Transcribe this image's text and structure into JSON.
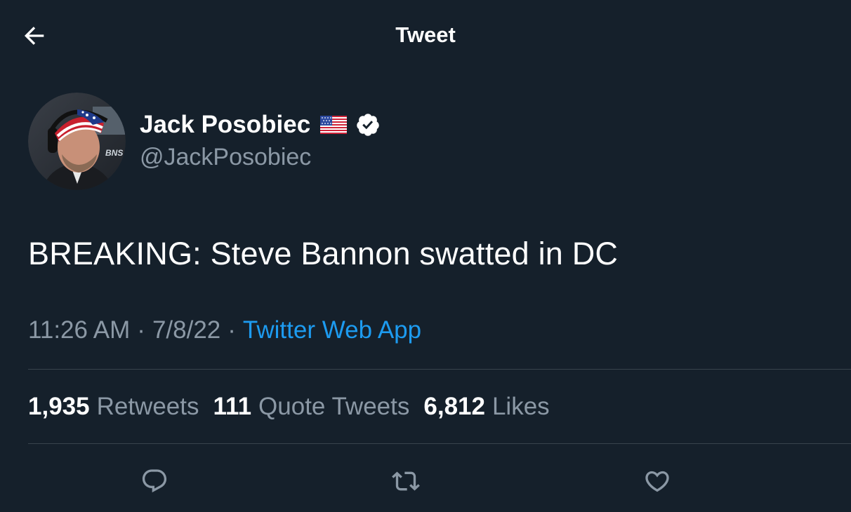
{
  "header": {
    "title": "Tweet",
    "back_icon": "arrow-left-icon"
  },
  "author": {
    "display_name": "Jack Posobiec",
    "handle": "@JackPosobiec",
    "flag_icon": "us-flag-icon",
    "verified_icon": "verified-badge-icon"
  },
  "tweet": {
    "text": "BREAKING: Steve Bannon swatted in DC",
    "time": "11:26 AM",
    "date": "7/8/22",
    "source": "Twitter Web App",
    "separator": "·"
  },
  "stats": {
    "retweets_count": "1,935",
    "retweets_label": "Retweets",
    "quotes_count": "111",
    "quotes_label": "Quote Tweets",
    "likes_count": "6,812",
    "likes_label": "Likes"
  },
  "actions": {
    "reply_icon": "reply-icon",
    "retweet_icon": "retweet-icon",
    "like_icon": "heart-icon"
  },
  "colors": {
    "background": "#15202b",
    "text_primary": "#ffffff",
    "text_secondary": "#8b98a5",
    "accent": "#1d9bf0",
    "divider": "#38444d"
  }
}
